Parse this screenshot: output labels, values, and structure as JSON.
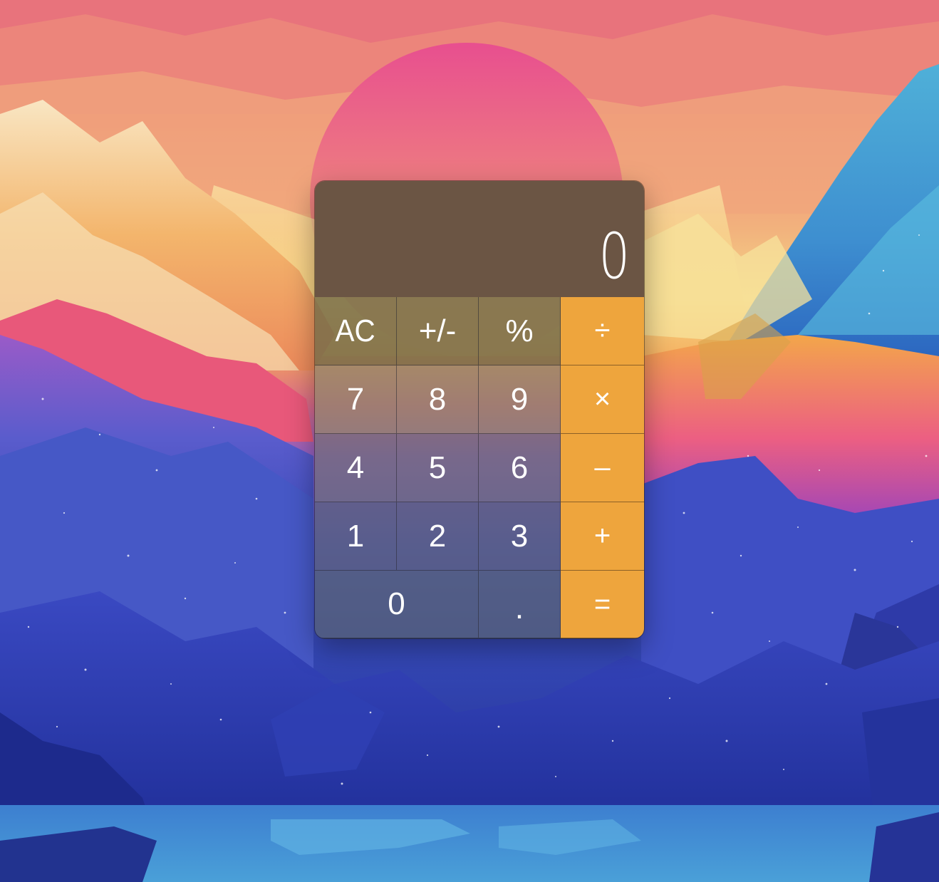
{
  "calculator": {
    "display_value": "0",
    "keys": {
      "clear": "AC",
      "negate": "+/-",
      "percent": "%",
      "divide": "÷",
      "seven": "7",
      "eight": "8",
      "nine": "9",
      "multiply": "×",
      "four": "4",
      "five": "5",
      "six": "6",
      "subtract": "–",
      "one": "1",
      "two": "2",
      "three": "3",
      "add": "+",
      "zero": "0",
      "decimal": ".",
      "equals": "="
    }
  },
  "colors": {
    "display_background": "#6b5544",
    "operator_key": "#eea53d",
    "key_text": "#ffffff"
  }
}
